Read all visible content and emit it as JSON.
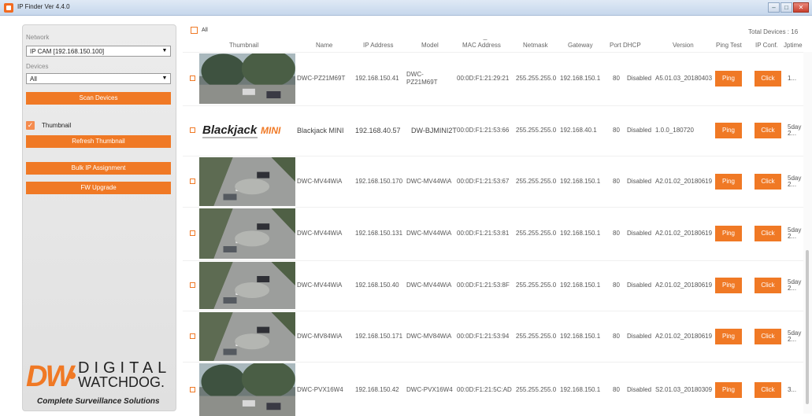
{
  "window": {
    "title": "IP Finder Ver 4.4.0",
    "minimize": "–",
    "maximize": "□",
    "close": "✕"
  },
  "left": {
    "network_label": "Network",
    "network_value": "IP CAM [192.168.150.100]",
    "devices_label": "Devices",
    "devices_value": "All",
    "scan_button": "Scan Devices",
    "thumbnail_label": "Thumbnail",
    "thumbnail_checked": true,
    "refresh_button": "Refresh Thumbnail",
    "bulk_button": "Bulk IP Assignment",
    "fw_button": "FW Upgrade",
    "logo": {
      "mark": "DW",
      "word1": "DIGITAL",
      "word2": "WATCHDOG.",
      "tagline": "Complete Surveillance Solutions"
    }
  },
  "header": {
    "all_label": "All",
    "total": "Total Devices : 16"
  },
  "columns": [
    "Thumbnail",
    "Name",
    "IP Address",
    "Model",
    "MAC Address",
    "Netmask",
    "Gateway",
    "Port",
    "DHCP",
    "Version",
    "Ping Test",
    "IP Conf.",
    "Jptime"
  ],
  "rows": [
    {
      "name": "DWC-PZ21M69T",
      "ip": "192.168.150.41",
      "model": [
        "DWC-",
        "PZ21M69T"
      ],
      "mac": "00:0D:F1:21:29:21",
      "netmask": "255.255.255.0",
      "gateway": "192.168.150.1",
      "port": "80",
      "dhcp": "Disabled",
      "version": "A5.01.03_20180403",
      "ping": "Ping",
      "conf": "Click",
      "uptime": [
        "1..."
      ],
      "big": false,
      "thumb": "outdoor-trees"
    },
    {
      "name": "Blackjack MINI",
      "ip": "192.168.40.57",
      "model": [
        "DW-BJMINI2T"
      ],
      "mac": "00:0D:F1:21:53:66",
      "netmask": "255.255.255.0",
      "gateway": "192.168.40.1",
      "port": "80",
      "dhcp": "Disabled",
      "version": "1.0.0_180720",
      "ping": "Ping",
      "conf": "Click",
      "uptime": [
        "5day",
        "2..."
      ],
      "big": true,
      "thumb": "blackjack-logo"
    },
    {
      "name": "DWC-MV44WiA",
      "ip": "192.168.150.170",
      "model": [
        "DWC-MV44WiA"
      ],
      "mac": "00:0D:F1:21:53:67",
      "netmask": "255.255.255.0",
      "gateway": "192.168.150.1",
      "port": "80",
      "dhcp": "Disabled",
      "version": "A2.01.02_20180619",
      "ping": "Ping",
      "conf": "Click",
      "uptime": [
        "5day",
        "2..."
      ],
      "big": false,
      "thumb": "parking-lot"
    },
    {
      "name": "DWC-MV44WiA",
      "ip": "192.168.150.131",
      "model": [
        "DWC-MV44WiA"
      ],
      "mac": "00:0D:F1:21:53:81",
      "netmask": "255.255.255.0",
      "gateway": "192.168.150.1",
      "port": "80",
      "dhcp": "Disabled",
      "version": "A2.01.02_20180619",
      "ping": "Ping",
      "conf": "Click",
      "uptime": [
        "5day",
        "2..."
      ],
      "big": false,
      "thumb": "parking-lot"
    },
    {
      "name": "DWC-MV44WiA",
      "ip": "192.168.150.40",
      "model": [
        "DWC-MV44WiA"
      ],
      "mac": "00:0D:F1:21:53:8F",
      "netmask": "255.255.255.0",
      "gateway": "192.168.150.1",
      "port": "80",
      "dhcp": "Disabled",
      "version": "A2.01.02_20180619",
      "ping": "Ping",
      "conf": "Click",
      "uptime": [
        "5day",
        "2..."
      ],
      "big": false,
      "thumb": "parking-lot"
    },
    {
      "name": "DWC-MV84WiA",
      "ip": "192.168.150.171",
      "model": [
        "DWC-MV84WiA"
      ],
      "mac": "00:0D:F1:21:53:94",
      "netmask": "255.255.255.0",
      "gateway": "192.168.150.1",
      "port": "80",
      "dhcp": "Disabled",
      "version": "A2.01.02_20180619",
      "ping": "Ping",
      "conf": "Click",
      "uptime": [
        "5day",
        "2..."
      ],
      "big": false,
      "thumb": "parking-lot"
    },
    {
      "name": "DWC-PVX16W4",
      "ip": "192.168.150.42",
      "model": [
        "DWC-PVX16W4"
      ],
      "mac": "00:0D:F1:21:5C:AD",
      "netmask": "255.255.255.0",
      "gateway": "192.168.150.1",
      "port": "80",
      "dhcp": "Disabled",
      "version": "S2.01.03_20180309",
      "ping": "Ping",
      "conf": "Click",
      "uptime": [
        "3..."
      ],
      "big": false,
      "thumb": "outdoor-trees"
    }
  ],
  "thumb_text": {
    "brand": "Blackjack",
    "brand_suffix": "MINI"
  },
  "colors": {
    "accent": "#f07925",
    "panel": "#e6e6e6"
  }
}
